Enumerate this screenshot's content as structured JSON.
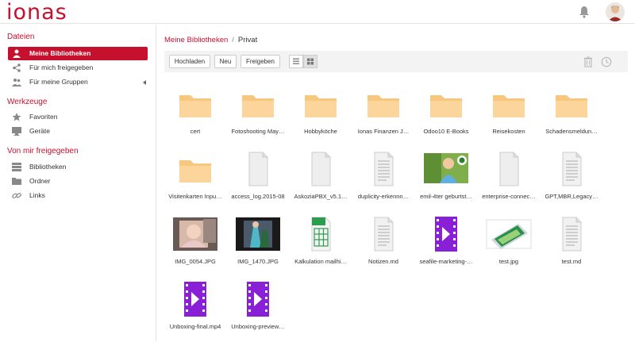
{
  "app": {
    "logo": "ionas"
  },
  "sidebar": {
    "sections": [
      {
        "title": "Dateien",
        "items": [
          {
            "label": "Meine Bibliotheken",
            "icon": "user-icon",
            "active": true
          },
          {
            "label": "Für mich freigegeben",
            "icon": "share-icon"
          },
          {
            "label": "Für meine Gruppen",
            "icon": "group-icon",
            "caret": true
          }
        ]
      },
      {
        "title": "Werkzeuge",
        "items": [
          {
            "label": "Favoriten",
            "icon": "star-icon"
          },
          {
            "label": "Geräte",
            "icon": "monitor-icon"
          }
        ]
      },
      {
        "title": "Von mir freigegeben",
        "items": [
          {
            "label": "Bibliotheken",
            "icon": "library-icon"
          },
          {
            "label": "Ordner",
            "icon": "folder-icon"
          },
          {
            "label": "Links",
            "icon": "link-icon"
          }
        ]
      }
    ]
  },
  "breadcrumb": {
    "root": "Meine Bibliotheken",
    "separator": "/",
    "current": "Privat"
  },
  "toolbar": {
    "upload": "Hochladen",
    "new": "Neu",
    "share": "Freigeben"
  },
  "colors": {
    "accent": "#c5102e",
    "folder": "#f7c77e",
    "video": "#8a1fd8",
    "sheet": "#2e9c4e"
  },
  "files": [
    {
      "name": "cert",
      "type": "folder"
    },
    {
      "name": "Fotoshooting May…",
      "type": "folder"
    },
    {
      "name": "Hobbyköche",
      "type": "folder"
    },
    {
      "name": "Ionas Finanzen J…",
      "type": "folder"
    },
    {
      "name": "Odoo10 E-Books",
      "type": "folder"
    },
    {
      "name": "Reisekosten",
      "type": "folder"
    },
    {
      "name": "Schadensmeldun…",
      "type": "folder"
    },
    {
      "name": "Visitenkarten Inpu…",
      "type": "folder"
    },
    {
      "name": "access_log.2015-08",
      "type": "blank"
    },
    {
      "name": "AskoziaPBX_v5.1…",
      "type": "blank"
    },
    {
      "name": "duplicity-erkennn…",
      "type": "text"
    },
    {
      "name": "emil-4ter geburtst…",
      "type": "image-green"
    },
    {
      "name": "enterprise-connec…",
      "type": "blank"
    },
    {
      "name": "GPT,MBR,Legacy…",
      "type": "text"
    },
    {
      "name": "IMG_0054.JPG",
      "type": "image-photo1"
    },
    {
      "name": "IMG_1470.JPG",
      "type": "image-photo2"
    },
    {
      "name": "Kalkulation mailhi…",
      "type": "sheet"
    },
    {
      "name": "Notizen.md",
      "type": "text"
    },
    {
      "name": "seafile-marketing-…",
      "type": "video"
    },
    {
      "name": "test.jpg",
      "type": "image-tablet"
    },
    {
      "name": "test.md",
      "type": "text"
    },
    {
      "name": "Unboxing-final.mp4",
      "type": "video"
    },
    {
      "name": "Unboxing-preview…",
      "type": "video"
    }
  ]
}
